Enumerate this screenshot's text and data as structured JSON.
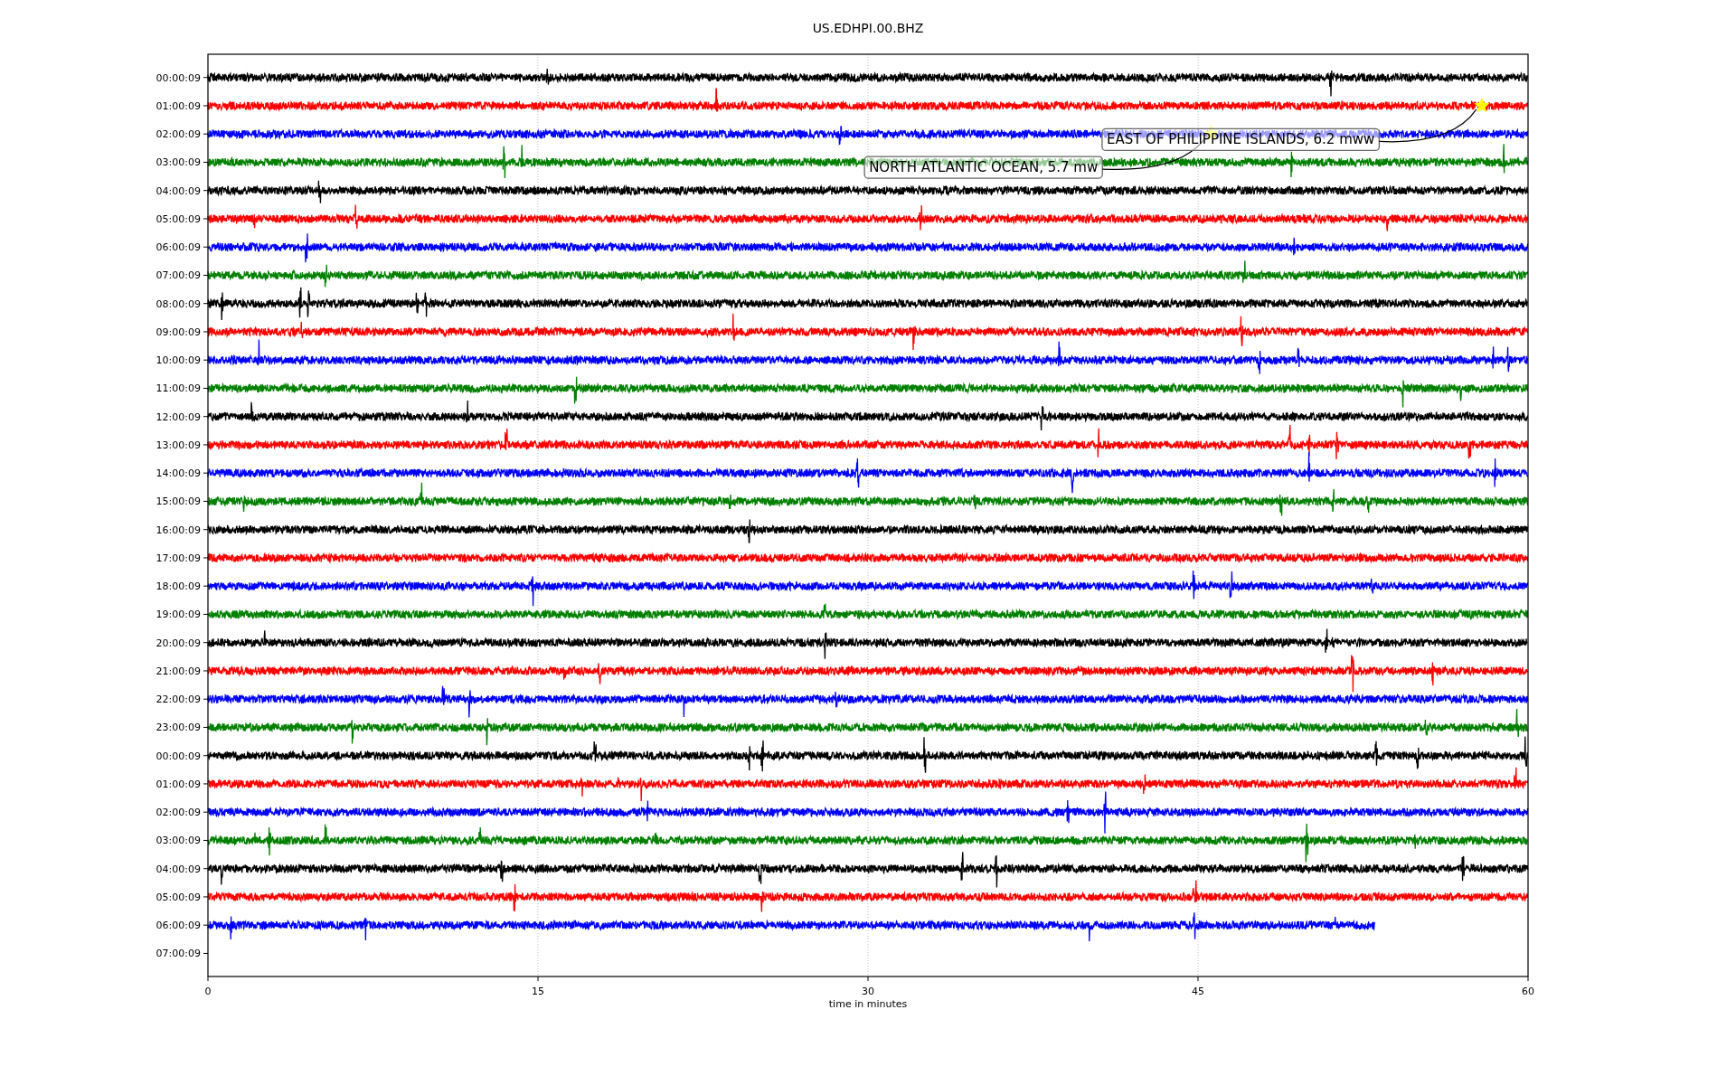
{
  "title": "US.EDHPI.00.BHZ",
  "xlabel": "time in minutes",
  "xticks": [
    "0",
    "15",
    "30",
    "45",
    "60"
  ],
  "rows": [
    {
      "label": "00:00:09",
      "color": "#000000",
      "level": 1
    },
    {
      "label": "01:00:09",
      "color": "#ff0000",
      "level": 1
    },
    {
      "label": "02:00:09",
      "color": "#0000ff",
      "level": 1
    },
    {
      "label": "03:00:09",
      "color": "#008000",
      "level": 1
    },
    {
      "label": "04:00:09",
      "color": "#000000",
      "level": 1
    },
    {
      "label": "05:00:09",
      "color": "#ff0000",
      "level": 1
    },
    {
      "label": "06:00:09",
      "color": "#0000ff",
      "level": 1
    },
    {
      "label": "07:00:09",
      "color": "#008000",
      "level": 1
    },
    {
      "label": "08:00:09",
      "color": "#000000",
      "level": 1
    },
    {
      "label": "09:00:09",
      "color": "#ff0000",
      "level": 1
    },
    {
      "label": "10:00:09",
      "color": "#0000ff",
      "level": 1
    },
    {
      "label": "11:00:09",
      "color": "#008000",
      "level": 1
    },
    {
      "label": "12:00:09",
      "color": "#000000",
      "level": 1
    },
    {
      "label": "13:00:09",
      "color": "#ff0000",
      "level": 1
    },
    {
      "label": "14:00:09",
      "color": "#0000ff",
      "level": 1
    },
    {
      "label": "15:00:09",
      "color": "#008000",
      "level": 1
    },
    {
      "label": "16:00:09",
      "color": "#000000",
      "level": 1
    },
    {
      "label": "17:00:09",
      "color": "#ff0000",
      "level": 1
    },
    {
      "label": "18:00:09",
      "color": "#0000ff",
      "level": 1
    },
    {
      "label": "19:00:09",
      "color": "#008000",
      "level": 1
    },
    {
      "label": "20:00:09",
      "color": "#000000",
      "level": 1
    },
    {
      "label": "21:00:09",
      "color": "#ff0000",
      "level": 1
    },
    {
      "label": "22:00:09",
      "color": "#0000ff",
      "level": 1
    },
    {
      "label": "23:00:09",
      "color": "#008000",
      "level": 1
    },
    {
      "label": "00:00:09",
      "color": "#000000",
      "level": 1
    },
    {
      "label": "01:00:09",
      "color": "#ff0000",
      "level": 1
    },
    {
      "label": "02:00:09",
      "color": "#0000ff",
      "level": 1
    },
    {
      "label": "03:00:09",
      "color": "#008000",
      "level": 1
    },
    {
      "label": "04:00:09",
      "color": "#000000",
      "level": 1
    },
    {
      "label": "05:00:09",
      "color": "#ff0000",
      "level": 1
    },
    {
      "label": "06:00:09",
      "color": "#0000ff",
      "level": 0.884
    },
    {
      "label": "07:00:09"
    }
  ],
  "annotations": [
    {
      "text": "EAST OF PHILIPPINE ISLANDS, 6.2 mww"
    },
    {
      "text": "NORTH ATLANTIC OCEAN, 5.7 mw"
    }
  ]
}
